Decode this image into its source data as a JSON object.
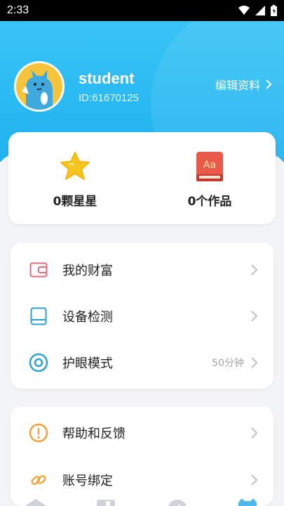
{
  "status_bar": {
    "time": "2:33"
  },
  "profile": {
    "username": "student",
    "user_id": "ID:61670125",
    "edit_label": "编辑资料"
  },
  "stats": [
    {
      "label": "0颗星星",
      "icon": "star-icon"
    },
    {
      "label": "0个作品",
      "icon": "book-icon"
    }
  ],
  "menu_group_1": [
    {
      "label": "我的财富",
      "icon": "wallet-icon",
      "value": ""
    },
    {
      "label": "设备检测",
      "icon": "tablet-icon",
      "value": ""
    },
    {
      "label": "护眼模式",
      "icon": "eye-icon",
      "value": "50分钟"
    }
  ],
  "menu_group_2": [
    {
      "label": "帮助和反馈",
      "icon": "warning-icon",
      "value": ""
    },
    {
      "label": "账号绑定",
      "icon": "link-icon",
      "value": ""
    }
  ],
  "colors": {
    "header": "#39c4f6",
    "star": "#f7c51e",
    "wallet": "#e46a7b",
    "device": "#2aa2d9",
    "eye": "#2aa2d9",
    "help": "#f0a236",
    "link": "#f0a236"
  }
}
